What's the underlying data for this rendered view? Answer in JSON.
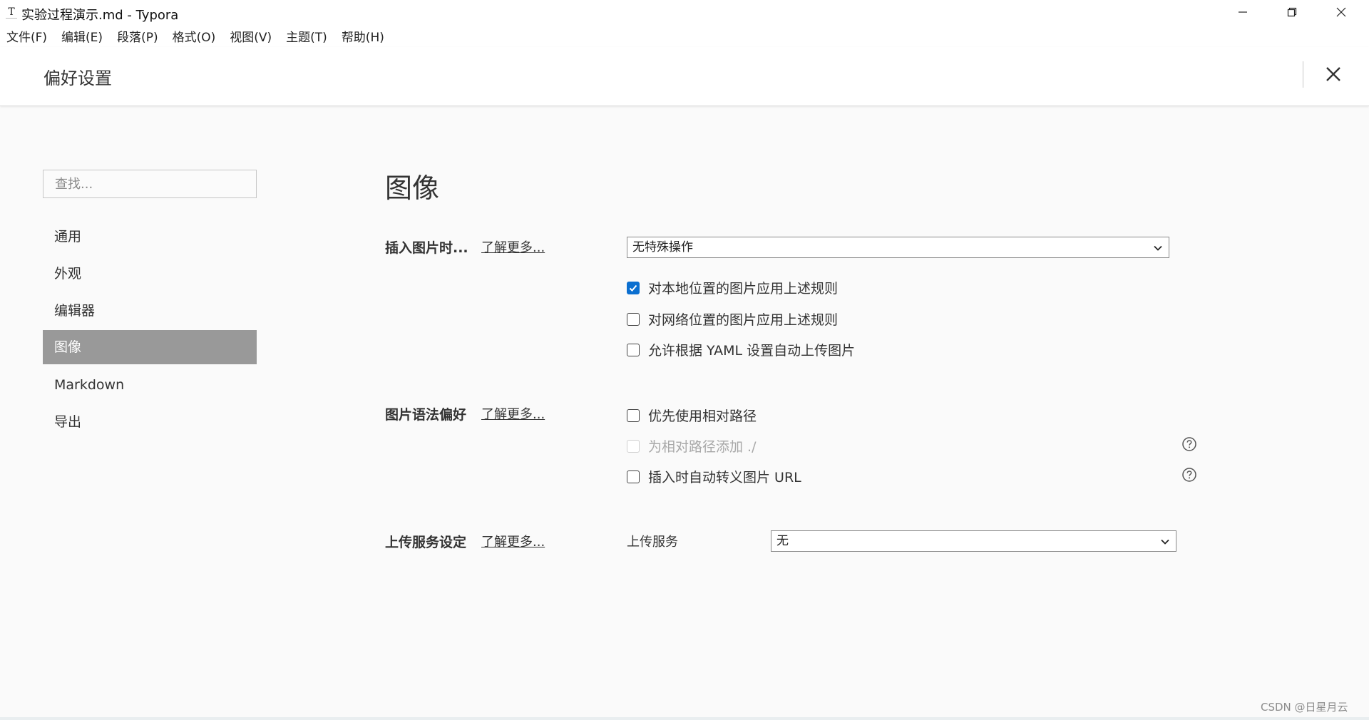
{
  "window": {
    "app_icon": "T",
    "title": "实验过程演示.md - Typora",
    "controls": [
      "minimize-icon",
      "restore-icon",
      "close-icon"
    ]
  },
  "menu": {
    "items": [
      "文件(F)",
      "编辑(E)",
      "段落(P)",
      "格式(O)",
      "视图(V)",
      "主题(T)",
      "帮助(H)"
    ]
  },
  "preferences": {
    "title": "偏好设置",
    "close_icon": "close-icon"
  },
  "sidebar": {
    "search_placeholder": "查找...",
    "items": [
      {
        "label": "通用",
        "active": false
      },
      {
        "label": "外观",
        "active": false
      },
      {
        "label": "编辑器",
        "active": false
      },
      {
        "label": "图像",
        "active": true
      },
      {
        "label": "Markdown",
        "active": false
      },
      {
        "label": "导出",
        "active": false
      }
    ]
  },
  "content": {
    "section_title": "图像",
    "insert_image": {
      "label": "插入图片时...",
      "learn_more": "了解更多...",
      "select_value": "无特殊操作",
      "options": [
        {
          "label": "对本地位置的图片应用上述规则",
          "checked": true
        },
        {
          "label": "对网络位置的图片应用上述规则",
          "checked": false
        },
        {
          "label": "允许根据 YAML 设置自动上传图片",
          "checked": false
        }
      ]
    },
    "image_syntax": {
      "label": "图片语法偏好",
      "learn_more": "了解更多...",
      "options": [
        {
          "label": "优先使用相对路径",
          "checked": false,
          "disabled": false
        },
        {
          "label": "为相对路径添加 ./",
          "checked": false,
          "disabled": true
        },
        {
          "label": "插入时自动转义图片 URL",
          "checked": false,
          "disabled": false
        }
      ]
    },
    "upload": {
      "label": "上传服务设定",
      "learn_more": "了解更多...",
      "service_label": "上传服务",
      "service_value": "无"
    }
  },
  "watermark": "CSDN @日星月云",
  "colors": {
    "accent": "#0b6fd0",
    "active_nav_bg": "#999999",
    "background": "#fafafa"
  }
}
